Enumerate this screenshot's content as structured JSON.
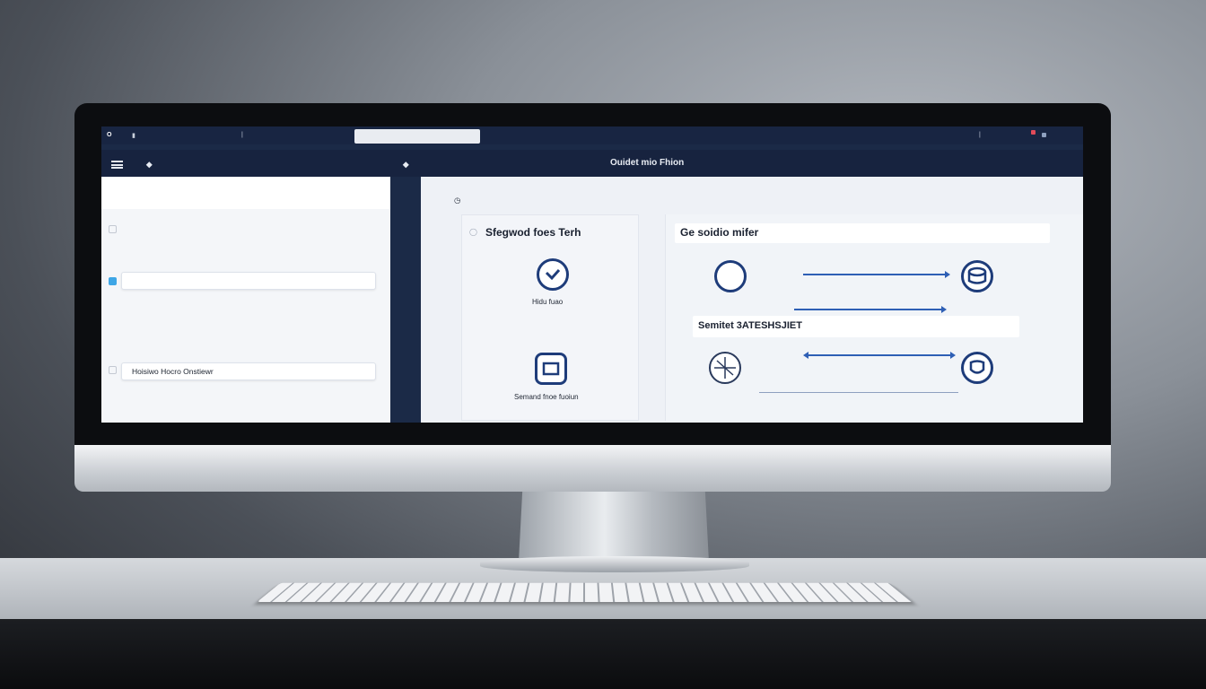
{
  "topbar": {
    "logo": "O",
    "items": [
      "",
      "",
      "",
      "",
      "",
      "",
      "",
      ""
    ],
    "search_text": "",
    "right_items": [
      "",
      ""
    ]
  },
  "nav": {
    "items": [
      "",
      "",
      "",
      "",
      "",
      "",
      "",
      "",
      "Ouidet mio Fhion"
    ]
  },
  "left_panel": {
    "links": [
      "",
      ""
    ],
    "intro": [
      "",
      ""
    ],
    "field1": "",
    "description": [
      "",
      ""
    ],
    "field2": "Hoisiwo Hocro  Onstiewr",
    "footer": ""
  },
  "right_panel": {
    "breadcrumb": "",
    "card1": {
      "title": "Sfegwod foes Terh",
      "item1_label": "Hidu fuao",
      "item2_label": "Semand fnoe fuoiun"
    },
    "card2": {
      "title": "Ge soidio mifer",
      "title_faded": "",
      "action": "",
      "icon1_text": "",
      "label_left_1": "",
      "label_right_1": "",
      "section_title": "Semitet 3ATESHSJIET",
      "section_sub": "",
      "label_left_2": "",
      "label_right_2": ""
    }
  },
  "colors": {
    "navy": "#182542",
    "accent_blue": "#2e5fb5",
    "link_blue": "#1b74c9",
    "icon_navy": "#1e3c7a"
  }
}
